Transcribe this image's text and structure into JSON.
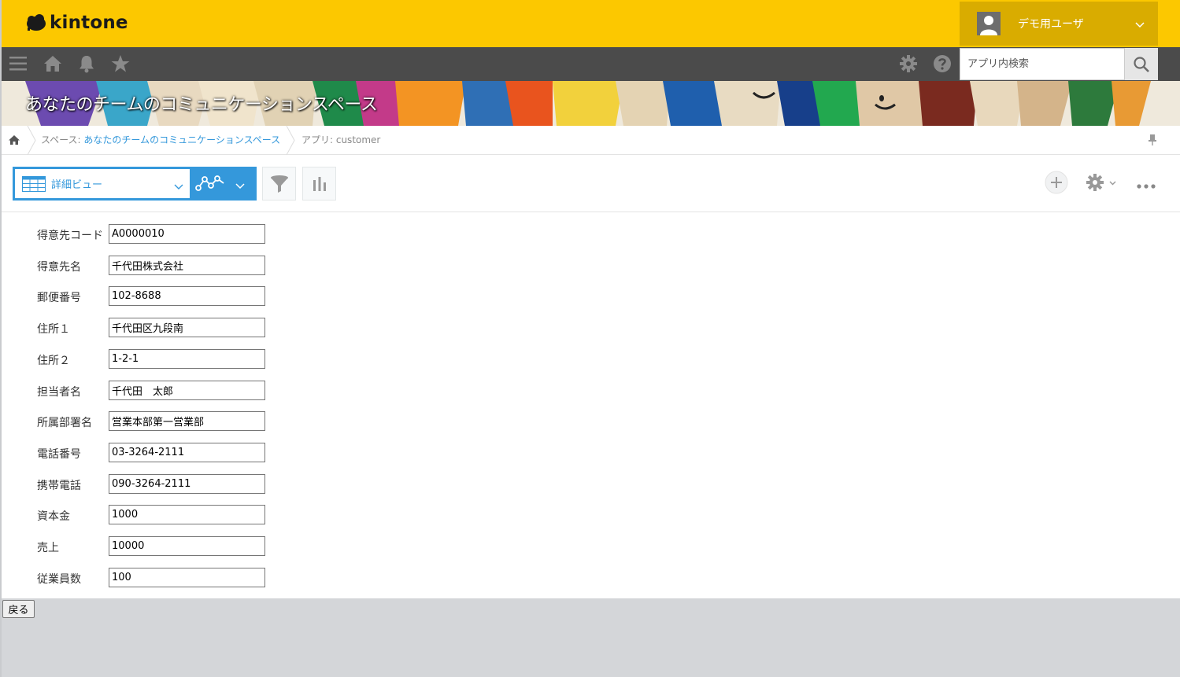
{
  "header": {
    "logo_text": "kintone",
    "user_name": "デモ用ユーザ",
    "brand_color": "#fcc800"
  },
  "nav": {
    "search_placeholder": "アプリ内検索"
  },
  "banner": {
    "title": "あなたのチームのコミュニケーションスペース"
  },
  "breadcrumb": {
    "space_prefix": "スペース: ",
    "space_name": "あなたのチームのコミュニケーションスペース",
    "app_label": "アプリ: customer"
  },
  "toolbar": {
    "view_name": "詳細ビュー"
  },
  "record": {
    "fields": [
      {
        "label": "得意先コード",
        "value": "A0000010"
      },
      {
        "label": "得意先名",
        "value": "千代田株式会社"
      },
      {
        "label": "郵便番号",
        "value": "102-8688"
      },
      {
        "label": "住所１",
        "value": "千代田区九段南"
      },
      {
        "label": "住所２",
        "value": "1-2-1"
      },
      {
        "label": "担当者名",
        "value": "千代田　太郎"
      },
      {
        "label": "所属部署名",
        "value": "営業本部第一営業部"
      },
      {
        "label": "電話番号",
        "value": "03-3264-2111"
      },
      {
        "label": "携帯電話",
        "value": "090-3264-2111"
      },
      {
        "label": "資本金",
        "value": "1000"
      },
      {
        "label": "売上",
        "value": "10000"
      },
      {
        "label": "従業員数",
        "value": "100"
      }
    ]
  },
  "footer": {
    "back_label": "戻る"
  }
}
